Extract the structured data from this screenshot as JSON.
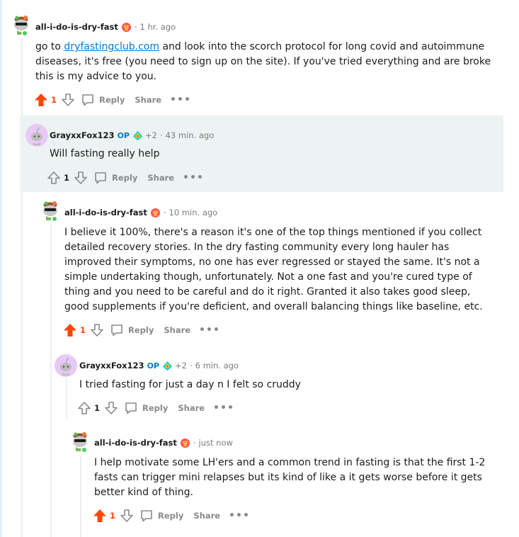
{
  "colors": {
    "upvote_active": "#ff4500",
    "link": "#0079d3",
    "op_badge": "#0079d3",
    "online": "#46d160",
    "highlight_bg": "#edf3f2"
  },
  "comments": [
    {
      "username": "all-i-do-is-dry-fast",
      "flair_icon": "trophy-flair-icon",
      "time": "1 hr. ago",
      "body_prefix": "go to ",
      "link_text": "dryfastingclub.com",
      "body_suffix": " and look into the scorch protocol for long covid and autoimmune diseases, it's free (you need to sign up on the site). If you've tried everything and are broke this is my advice to you.",
      "votes": "1",
      "reply_label": "Reply",
      "share_label": "Share",
      "more_label": "•••"
    },
    {
      "username": "GrayxxFox123",
      "op_label": "OP",
      "flair_icon": "snoo-flair-icon",
      "karma": "+2",
      "time": "43 min. ago",
      "body": "Will fasting really help",
      "votes": "1",
      "reply_label": "Reply",
      "share_label": "Share",
      "more_label": "•••"
    },
    {
      "username": "all-i-do-is-dry-fast",
      "flair_icon": "trophy-flair-icon",
      "time": "10 min. ago",
      "body": "I believe it 100%, there's a reason it's one of the top things mentioned if you collect detailed recovery stories. In the dry fasting community every long hauler has improved their symptoms, no one has ever regressed or stayed the same. It's not a simple undertaking though, unfortunately. Not a one fast and you're cured type of thing and you need to be careful and do it right. Granted it also takes good sleep, good supplements if you're deficient, and overall balancing things like baseline, etc.",
      "votes": "1",
      "reply_label": "Reply",
      "share_label": "Share",
      "more_label": "•••"
    },
    {
      "username": "GrayxxFox123",
      "op_label": "OP",
      "flair_icon": "snoo-flair-icon",
      "karma": "+2",
      "time": "6 min. ago",
      "body": "I tried fasting for just a day n I felt so cruddy",
      "votes": "1",
      "reply_label": "Reply",
      "share_label": "Share",
      "more_label": "•••"
    },
    {
      "username": "all-i-do-is-dry-fast",
      "flair_icon": "trophy-flair-icon",
      "time": "just now",
      "body": "I help motivate some LH'ers and a common trend in fasting is that the first 1-2 fasts can trigger mini relapses but its kind of like a it gets worse before it gets better kind of thing.",
      "votes": "1",
      "reply_label": "Reply",
      "share_label": "Share",
      "more_label": "•••"
    }
  ]
}
